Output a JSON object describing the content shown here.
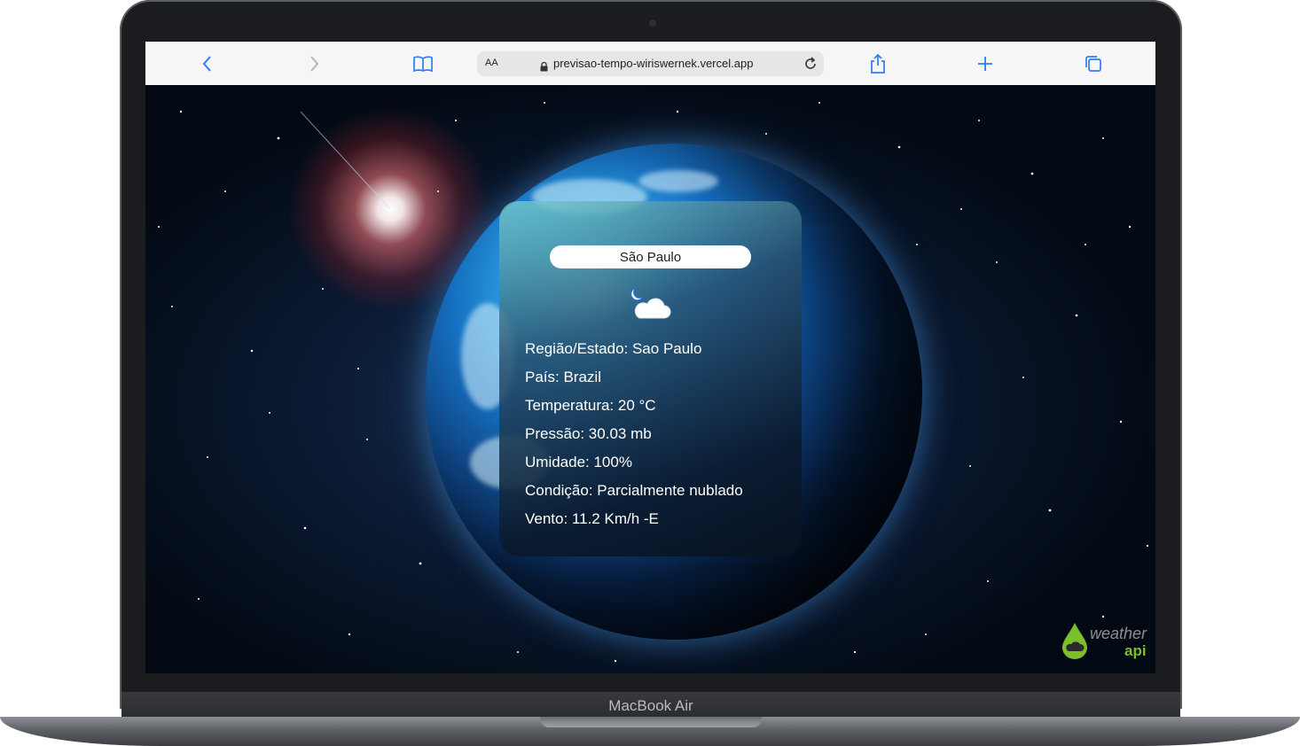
{
  "browser": {
    "aa_label": "AA",
    "url": "previsao-tempo-wiriswernek.vercel.app"
  },
  "weather": {
    "search_value": "São Paulo",
    "icon": "partly-cloudy-night-icon",
    "details": [
      "Região/Estado: Sao Paulo",
      "País: Brazil",
      "Temperatura: 20 °C",
      "Pressão: 30.03 mb",
      "Umidade: 100%",
      "Condição: Parcialmente nublado",
      "Vento: 11.2 Km/h -E"
    ]
  },
  "logo": {
    "line1": "weather",
    "line2": "api"
  },
  "device": {
    "label": "MacBook Air"
  },
  "colors": {
    "accent": "#2f7cf6",
    "logo_green": "#7bbf2a"
  }
}
